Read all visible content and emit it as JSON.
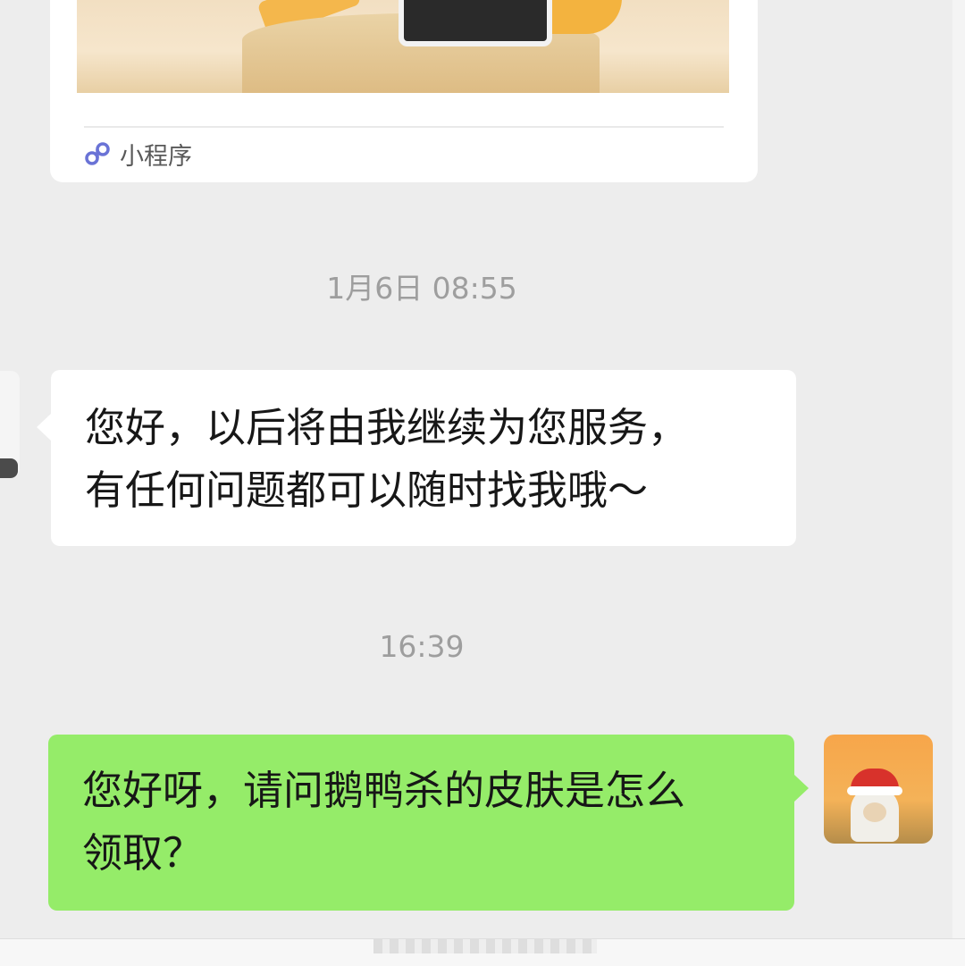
{
  "mini_program_card": {
    "label": "小程序",
    "icon": "mini-program-link-icon"
  },
  "messages": [
    {
      "type": "timestamp",
      "text": "1月6日 08:55"
    },
    {
      "type": "incoming",
      "lines": [
        "您好，以后将由我继续为您服务，",
        "有任何问题都可以随时找我哦～"
      ]
    },
    {
      "type": "timestamp",
      "text": "16:39"
    },
    {
      "type": "outgoing",
      "lines": [
        "您好呀，请问鹅鸭杀的皮肤是怎么",
        "领取？"
      ]
    }
  ],
  "colors": {
    "background": "#ededed",
    "incoming_bubble": "#ffffff",
    "outgoing_bubble": "#95ec69",
    "timestamp": "#9e9e9e"
  }
}
